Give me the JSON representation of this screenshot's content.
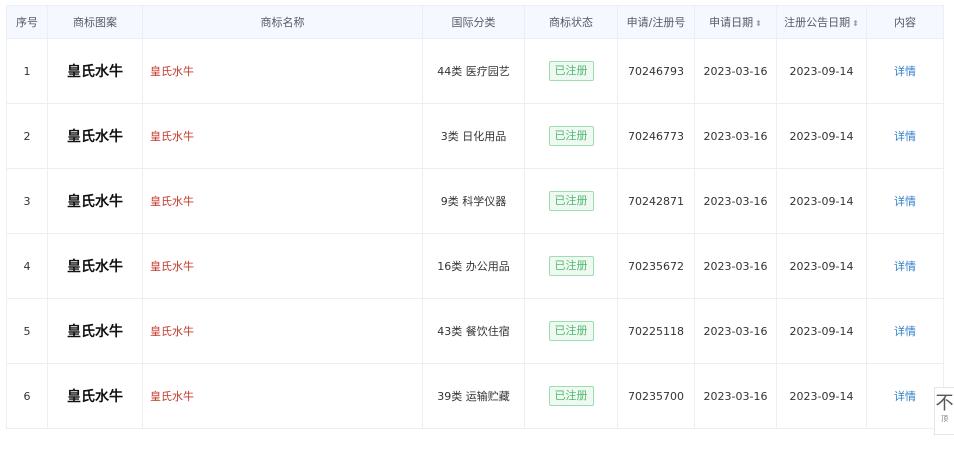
{
  "table": {
    "headers": {
      "index": "序号",
      "logo": "商标图案",
      "name": "商标名称",
      "class": "国际分类",
      "status": "商标状态",
      "reg_no": "申请/注册号",
      "apply_date": "申请日期",
      "notice_date": "注册公告日期",
      "content": "内容"
    },
    "sort_icon": "sort-caret-icon",
    "rows": [
      {
        "index": "1",
        "logo_text": "皇氏水牛",
        "name": "皇氏水牛",
        "class": "44类 医疗园艺",
        "status": "已注册",
        "reg_no": "70246793",
        "apply_date": "2023-03-16",
        "notice_date": "2023-09-14",
        "link": "详情"
      },
      {
        "index": "2",
        "logo_text": "皇氏水牛",
        "name": "皇氏水牛",
        "class": "3类 日化用品",
        "status": "已注册",
        "reg_no": "70246773",
        "apply_date": "2023-03-16",
        "notice_date": "2023-09-14",
        "link": "详情"
      },
      {
        "index": "3",
        "logo_text": "皇氏水牛",
        "name": "皇氏水牛",
        "class": "9类 科学仪器",
        "status": "已注册",
        "reg_no": "70242871",
        "apply_date": "2023-03-16",
        "notice_date": "2023-09-14",
        "link": "详情"
      },
      {
        "index": "4",
        "logo_text": "皇氏水牛",
        "name": "皇氏水牛",
        "class": "16类 办公用品",
        "status": "已注册",
        "reg_no": "70235672",
        "apply_date": "2023-03-16",
        "notice_date": "2023-09-14",
        "link": "详情"
      },
      {
        "index": "5",
        "logo_text": "皇氏水牛",
        "name": "皇氏水牛",
        "class": "43类 餐饮住宿",
        "status": "已注册",
        "reg_no": "70225118",
        "apply_date": "2023-03-16",
        "notice_date": "2023-09-14",
        "link": "详情"
      },
      {
        "index": "6",
        "logo_text": "皇氏水牛",
        "name": "皇氏水牛",
        "class": "39类 运输贮藏",
        "status": "已注册",
        "reg_no": "70235700",
        "apply_date": "2023-03-16",
        "notice_date": "2023-09-14",
        "link": "详情"
      }
    ]
  },
  "colors": {
    "header_bg": "#f5f8fe",
    "name_text": "#c0392b",
    "status_green": "#52b86f",
    "link_blue": "#2f7fc7"
  },
  "back_to_top": {
    "icon": "arrow-up-icon",
    "label": "顶"
  }
}
